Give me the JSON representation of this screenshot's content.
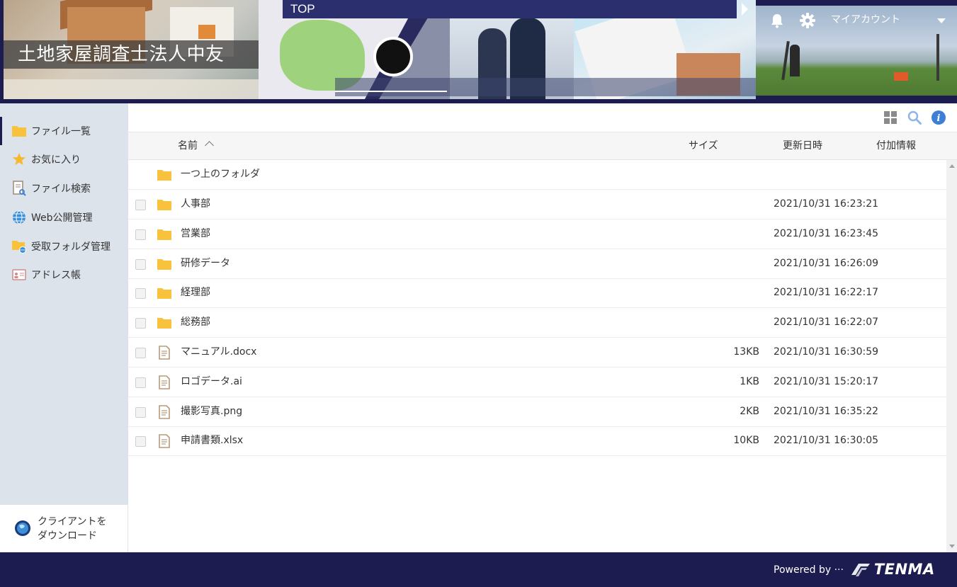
{
  "header": {
    "company_name": "土地家屋調査士法人中友",
    "nav_label": "TOP",
    "account_label": "マイアカウント"
  },
  "sidebar": {
    "items": [
      {
        "label": "ファイル一覧",
        "icon": "folder-icon"
      },
      {
        "label": "お気に入り",
        "icon": "star-icon"
      },
      {
        "label": "ファイル検索",
        "icon": "file-search-icon"
      },
      {
        "label": "Web公開管理",
        "icon": "globe-icon"
      },
      {
        "label": "受取フォルダ管理",
        "icon": "folder-globe-icon"
      },
      {
        "label": "アドレス帳",
        "icon": "address-card-icon"
      }
    ],
    "download": {
      "line1": "クライアントを",
      "line2": "ダウンロード"
    }
  },
  "table": {
    "columns": {
      "name": "名前",
      "size": "サイズ",
      "modified": "更新日時",
      "extra": "付加情報"
    },
    "parent_folder": "一つ上のフォルダ",
    "rows": [
      {
        "type": "folder",
        "name": "人事部",
        "size": "",
        "modified": "2021/10/31 16:23:21"
      },
      {
        "type": "folder",
        "name": "営業部",
        "size": "",
        "modified": "2021/10/31 16:23:45"
      },
      {
        "type": "folder",
        "name": "研修データ",
        "size": "",
        "modified": "2021/10/31 16:26:09"
      },
      {
        "type": "folder",
        "name": "経理部",
        "size": "",
        "modified": "2021/10/31 16:22:17"
      },
      {
        "type": "folder",
        "name": "総務部",
        "size": "",
        "modified": "2021/10/31 16:22:07"
      },
      {
        "type": "file",
        "name": "マニュアル.docx",
        "size": "13KB",
        "modified": "2021/10/31 16:30:59"
      },
      {
        "type": "file",
        "name": "ロゴデータ.ai",
        "size": "1KB",
        "modified": "2021/10/31 15:20:17"
      },
      {
        "type": "file",
        "name": "撮影写真.png",
        "size": "2KB",
        "modified": "2021/10/31 16:35:22"
      },
      {
        "type": "file",
        "name": "申請書類.xlsx",
        "size": "10KB",
        "modified": "2021/10/31 16:30:05"
      }
    ]
  },
  "footer": {
    "powered_by": "Powered by ···",
    "brand": "TENMA"
  },
  "colors": {
    "navy": "#1c1c50",
    "folder": "#f9c23c",
    "file": "#b59a7a",
    "info": "#3d7fd6"
  }
}
